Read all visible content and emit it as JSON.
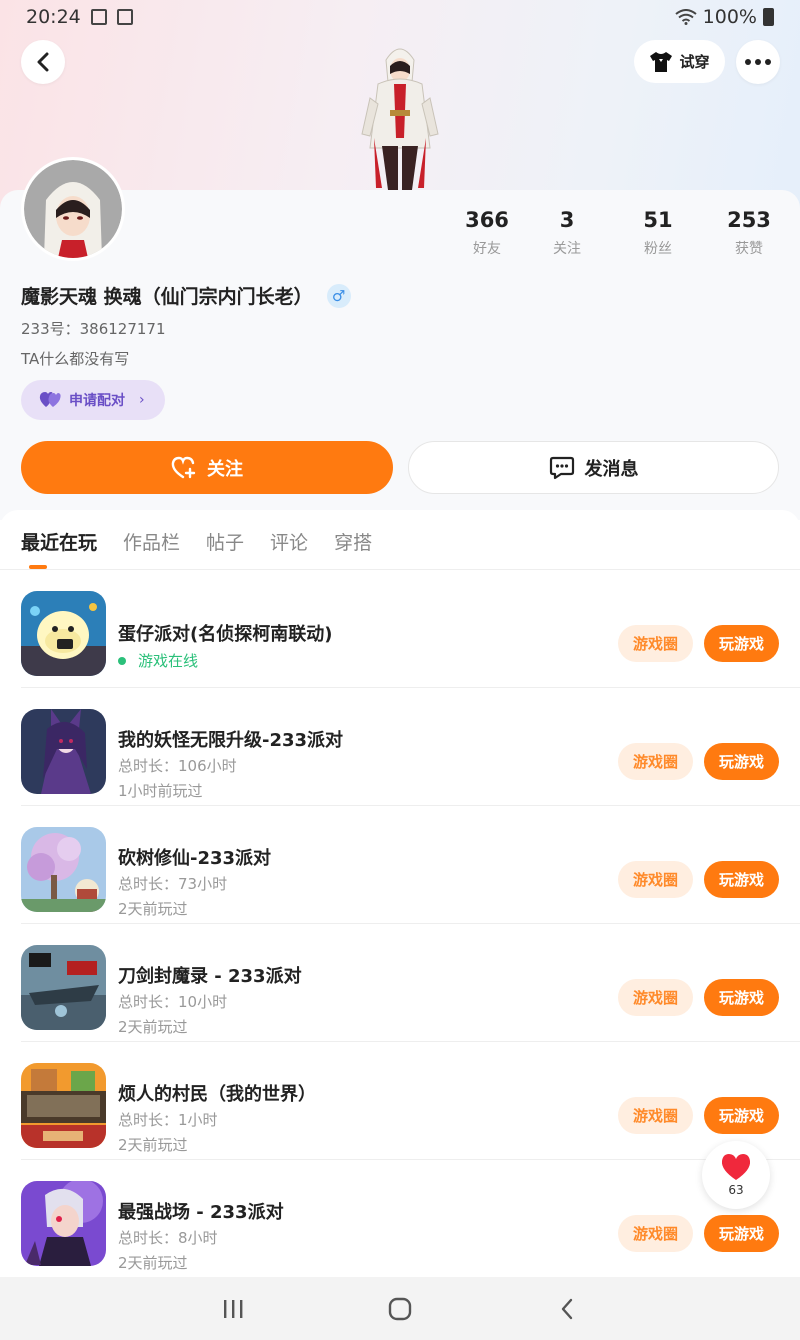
{
  "status_bar": {
    "time": "20:24",
    "battery": "100%"
  },
  "header": {
    "try_on_label": "试穿"
  },
  "profile": {
    "stats": [
      {
        "value": "366",
        "label": "好友"
      },
      {
        "value": "3",
        "label": "关注"
      },
      {
        "value": "51",
        "label": "粉丝"
      },
      {
        "value": "253",
        "label": "获赞"
      }
    ],
    "username": "魔影天魂 换魂（仙门宗内门长老）",
    "gender_symbol": "♂",
    "uid": "233号：386127171",
    "bio": "TA什么都没有写",
    "pair_label": "申请配对",
    "follow_label": "关注",
    "message_label": "发消息"
  },
  "tabs": [
    {
      "label": "最近在玩",
      "active": true
    },
    {
      "label": "作品栏",
      "active": false
    },
    {
      "label": "帖子",
      "active": false
    },
    {
      "label": "评论",
      "active": false
    },
    {
      "label": "穿搭",
      "active": false
    }
  ],
  "games": [
    {
      "title": "蛋仔派对(名侦探柯南联动)",
      "status": "游戏在线",
      "circle_label": "游戏圈",
      "play_label": "玩游戏"
    },
    {
      "title": "我的妖怪无限升级-233派对",
      "duration": "总时长：106小时",
      "last_played": "1小时前玩过",
      "circle_label": "游戏圈",
      "play_label": "玩游戏"
    },
    {
      "title": "砍树修仙-233派对",
      "duration": "总时长：73小时",
      "last_played": "2天前玩过",
      "circle_label": "游戏圈",
      "play_label": "玩游戏"
    },
    {
      "title": "刀剑封魔录 - 233派对",
      "duration": "总时长：10小时",
      "last_played": "2天前玩过",
      "circle_label": "游戏圈",
      "play_label": "玩游戏"
    },
    {
      "title": "烦人的村民（我的世界）",
      "duration": "总时长：1小时",
      "last_played": "2天前玩过",
      "circle_label": "游戏圈",
      "play_label": "玩游戏"
    },
    {
      "title": "最强战场 - 233派对",
      "duration": "总时长：8小时",
      "last_played": "2天前玩过",
      "circle_label": "游戏圈",
      "play_label": "玩游戏"
    }
  ],
  "like_float": {
    "count": "63"
  },
  "colors": {
    "accent": "#ff7a10",
    "online": "#2bc07a",
    "pair_bg": "#e8e0f7"
  }
}
